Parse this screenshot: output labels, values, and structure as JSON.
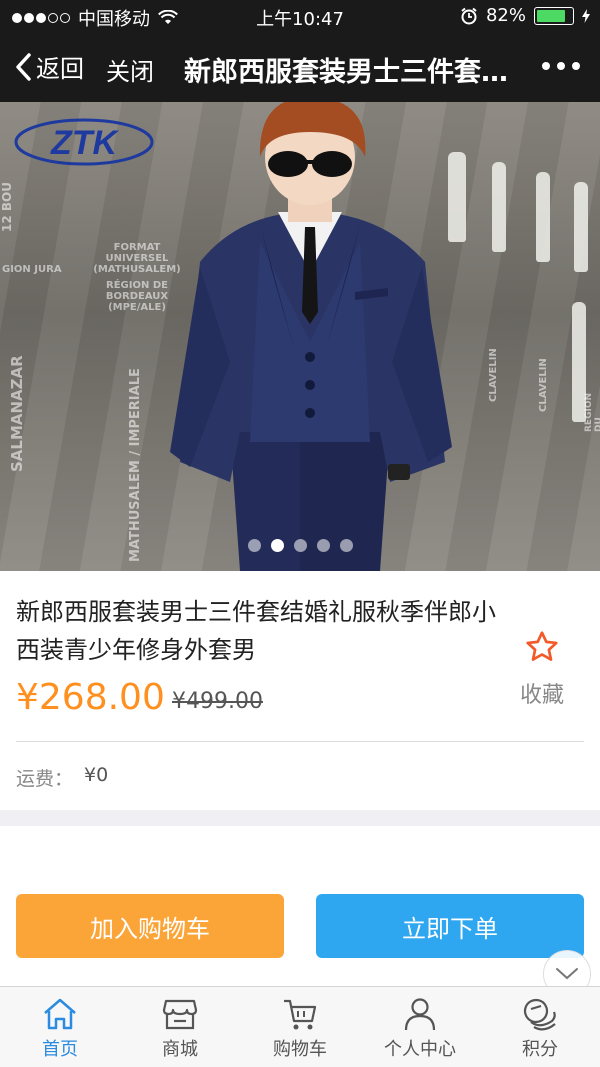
{
  "status_bar": {
    "carrier": "中国移动",
    "time": "上午10:47",
    "battery": "82%",
    "battery_level": 0.82
  },
  "nav": {
    "back_label": "返回",
    "close_label": "关闭",
    "title": "新郎西服套装男士三件套结婚礼服秋季伴郎小西装青少年修身外套男"
  },
  "hero": {
    "brand_logo": "ZTK",
    "wall_texts": [
      "12 BOU",
      "FORMAT UNIVERSEL (MATHUSALEM)",
      "RÉGION DE BORDEAUX (MPE/ALE)",
      "SALMANAZAR",
      "MATHUSALEM / IMPERIALE",
      "GION JURA",
      "CLAVELIN",
      "CLAVELIN",
      "REGION DU JURA"
    ],
    "carousel_count": 5,
    "carousel_active_index": 1
  },
  "product": {
    "name": "新郎西服套装男士三件套结婚礼服秋季伴郎小西装青少年修身外套男",
    "price": "¥268.00",
    "original_price": "¥499.00",
    "favorite_label": "收藏",
    "favorite_icon": "star-outline-icon",
    "shipping_label": "运费：",
    "shipping_value": "¥0"
  },
  "actions": {
    "add_to_cart": "加入购物车",
    "buy_now": "立即下单"
  },
  "tab_bar": {
    "items": [
      {
        "label": "首页",
        "icon": "home-icon",
        "active": true
      },
      {
        "label": "商城",
        "icon": "store-icon",
        "active": false
      },
      {
        "label": "购物车",
        "icon": "cart-icon",
        "active": false
      },
      {
        "label": "个人中心",
        "icon": "user-icon",
        "active": false
      },
      {
        "label": "积分",
        "icon": "coins-icon",
        "active": false
      }
    ]
  },
  "colors": {
    "accent_orange": "#ff9020",
    "cart_button": "#fba539",
    "buy_button": "#2ea6f0",
    "active_tab": "#2a8be0",
    "favorite_star": "#f25a2a"
  }
}
